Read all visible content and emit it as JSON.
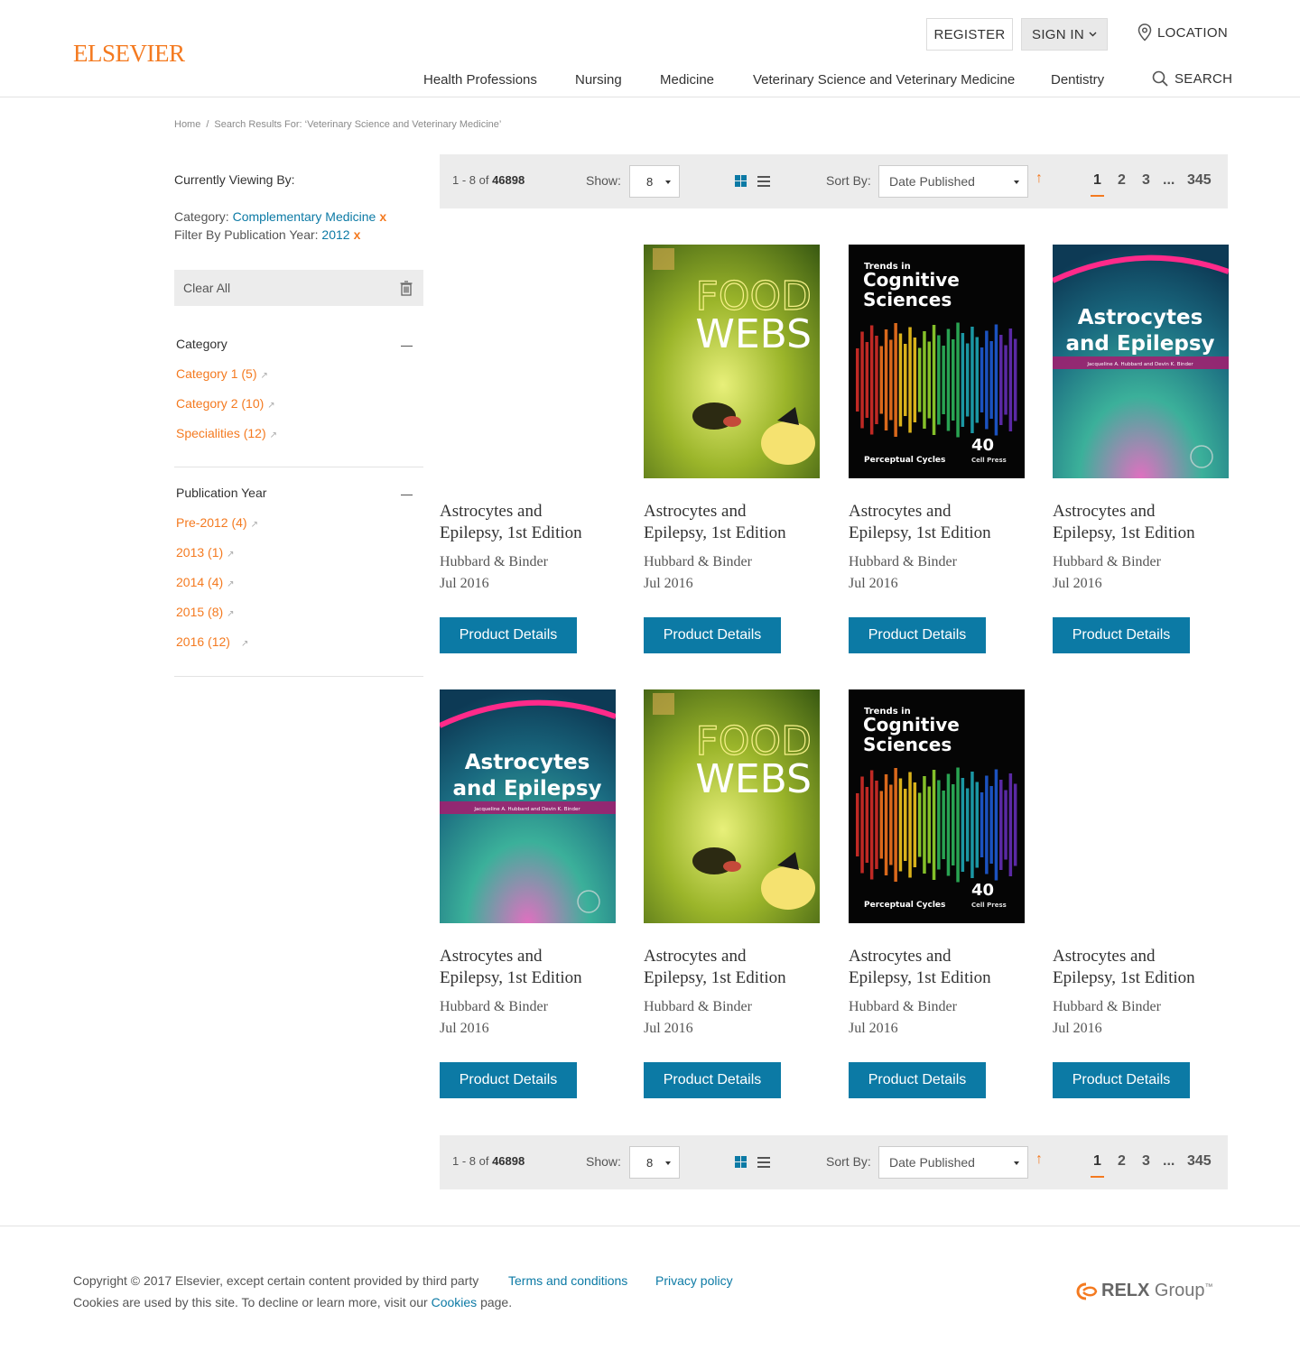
{
  "header": {
    "logo": "ELSEVIER",
    "register": "REGISTER",
    "sign_in": "SIGN IN",
    "location": "LOCATION",
    "search": "SEARCH",
    "nav": [
      "Health Professions",
      "Nursing",
      "Medicine",
      "Veterinary Science and Veterinary Medicine",
      "Dentistry"
    ]
  },
  "breadcrumb": {
    "home": "Home",
    "separator": "/",
    "current": "Search Results For: ‘Veterinary Science and Veterinary Medicine’"
  },
  "sidebar": {
    "currently_viewing": "Currently Viewing By:",
    "filters": [
      {
        "label": "Category: ",
        "value": "Complementary Medicine",
        "remove": "x"
      },
      {
        "label": "Filter By Publication Year: ",
        "value": "2012",
        "remove": "x"
      }
    ],
    "clear_all": "Clear All",
    "category": {
      "title": "Category",
      "items": [
        "Category 1 (5)",
        "Category 2 (10)",
        "Specialities (12)"
      ]
    },
    "publication_year": {
      "title": "Publication Year",
      "items": [
        "Pre-2012 (4)",
        "2013 (1)",
        "2014 (4)",
        "2015 (8)",
        "2016 (12)"
      ]
    }
  },
  "toolbar": {
    "range": "1 - 8 of ",
    "total": "46898",
    "show_label": "Show:",
    "show_value": "8",
    "sort_label": "Sort By:",
    "sort_value": "Date Published",
    "sort_direction_icon": "arrow-up",
    "pages": [
      "1",
      "2",
      "3",
      "...",
      "345"
    ],
    "active_page": "1"
  },
  "products": [
    {
      "cover": "none",
      "title_line1": "Astrocytes and",
      "title_line2": "Epilepsy, 1st Edition",
      "author": "Hubbard & Binder",
      "date": "Jul 2016",
      "button": "Product Details"
    },
    {
      "cover": "food-webs",
      "cover_text": [
        "FOOD",
        "WEBS"
      ],
      "title_line1": "Astrocytes and",
      "title_line2": "Epilepsy, 1st Edition",
      "author": "Hubbard & Binder",
      "date": "Jul 2016",
      "button": "Product Details"
    },
    {
      "cover": "cognitive",
      "cover_text": [
        "Trends in",
        "Cognitive",
        "Sciences",
        "Perceptual Cycles",
        "40",
        "Cell Press"
      ],
      "title_line1": "Astrocytes and",
      "title_line2": "Epilepsy, 1st Edition",
      "author": "Hubbard & Binder",
      "date": "Jul 2016",
      "button": "Product Details"
    },
    {
      "cover": "astrocytes",
      "cover_text": [
        "Astrocytes",
        "and Epilepsy",
        "Jacqueline A. Hubbard and Devin K. Binder"
      ],
      "title_line1": "Astrocytes and",
      "title_line2": "Epilepsy, 1st Edition",
      "author": "Hubbard & Binder",
      "date": "Jul 2016",
      "button": "Product Details"
    },
    {
      "cover": "astrocytes",
      "cover_text": [
        "Astrocytes",
        "and Epilepsy",
        "Jacqueline A. Hubbard and Devin K. Binder"
      ],
      "title_line1": "Astrocytes and",
      "title_line2": "Epilepsy, 1st Edition",
      "author": "Hubbard & Binder",
      "date": "Jul 2016",
      "button": "Product Details"
    },
    {
      "cover": "food-webs",
      "cover_text": [
        "FOOD",
        "WEBS"
      ],
      "title_line1": "Astrocytes and",
      "title_line2": "Epilepsy, 1st Edition",
      "author": "Hubbard & Binder",
      "date": "Jul 2016",
      "button": "Product Details"
    },
    {
      "cover": "cognitive",
      "cover_text": [
        "Trends in",
        "Cognitive",
        "Sciences",
        "Perceptual Cycles",
        "40",
        "Cell Press"
      ],
      "title_line1": "Astrocytes and",
      "title_line2": "Epilepsy, 1st Edition",
      "author": "Hubbard & Binder",
      "date": "Jul 2016",
      "button": "Product Details"
    },
    {
      "cover": "none",
      "title_line1": "Astrocytes and",
      "title_line2": "Epilepsy, 1st Edition",
      "author": "Hubbard & Binder",
      "date": "Jul 2016",
      "button": "Product Details"
    }
  ],
  "footer": {
    "copyright": "Copyright © 2017 Elsevier, except certain content provided by third party",
    "terms": "Terms and conditions",
    "privacy": "Privacy policy",
    "cookies_prefix": "Cookies are used by this site. To decline or learn more, visit our ",
    "cookies_link": "Cookies",
    "cookies_suffix": " page.",
    "relx_bold": "RELX",
    "relx_rest": " Group",
    "relx_tm": "™"
  },
  "colors": {
    "brand_orange": "#f47a20",
    "primary_blue": "#0c7aa5",
    "toolbar_gray": "#ececec"
  }
}
